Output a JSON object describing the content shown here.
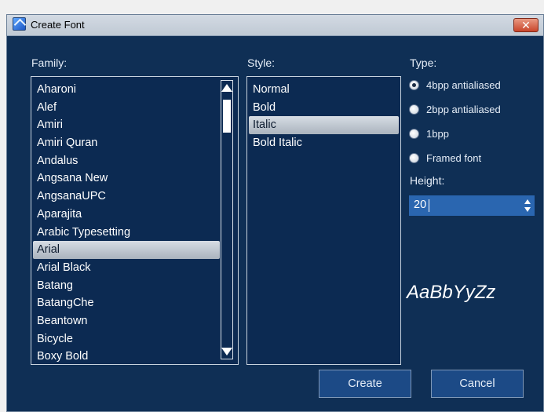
{
  "window": {
    "title": "Create Font",
    "close_label": "✕"
  },
  "family": {
    "label": "Family:",
    "items": [
      "Aharoni",
      "Alef",
      "Amiri",
      "Amiri Quran",
      "Andalus",
      "Angsana New",
      "AngsanaUPC",
      "Aparajita",
      "Arabic Typesetting",
      "Arial",
      "Arial Black",
      "Batang",
      "BatangChe",
      "Beantown",
      "Bicycle",
      "Boxy Bold"
    ],
    "selected": "Arial"
  },
  "style": {
    "label": "Style:",
    "items": [
      "Normal",
      "Bold",
      "Italic",
      "Bold Italic"
    ],
    "selected": "Italic"
  },
  "type": {
    "label": "Type:",
    "options": [
      "4bpp antialiased",
      "2bpp antialiased",
      "1bpp",
      "Framed font"
    ],
    "selected": "4bpp antialiased"
  },
  "height": {
    "label": "Height:",
    "value": "20"
  },
  "preview": {
    "text": "AaBbYyZz"
  },
  "buttons": {
    "create": "Create",
    "cancel": "Cancel"
  },
  "icons": {
    "app": "font-app-icon",
    "close": "close-icon",
    "scroll_up": "triangle-up-icon",
    "scroll_down": "triangle-down-icon"
  },
  "colors": {
    "background": "#0f2f55",
    "list_bg": "#0c2a52",
    "spin_bg": "#2a66b0",
    "close_button": "#c9452b"
  }
}
